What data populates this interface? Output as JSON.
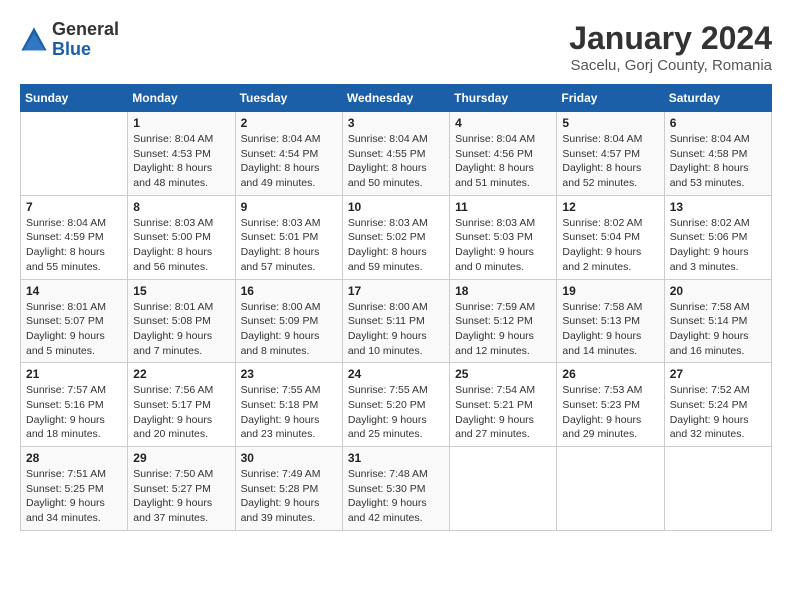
{
  "header": {
    "logo_general": "General",
    "logo_blue": "Blue",
    "title": "January 2024",
    "subtitle": "Sacelu, Gorj County, Romania"
  },
  "weekdays": [
    "Sunday",
    "Monday",
    "Tuesday",
    "Wednesday",
    "Thursday",
    "Friday",
    "Saturday"
  ],
  "weeks": [
    [
      {
        "day": "",
        "info": ""
      },
      {
        "day": "1",
        "info": "Sunrise: 8:04 AM\nSunset: 4:53 PM\nDaylight: 8 hours\nand 48 minutes."
      },
      {
        "day": "2",
        "info": "Sunrise: 8:04 AM\nSunset: 4:54 PM\nDaylight: 8 hours\nand 49 minutes."
      },
      {
        "day": "3",
        "info": "Sunrise: 8:04 AM\nSunset: 4:55 PM\nDaylight: 8 hours\nand 50 minutes."
      },
      {
        "day": "4",
        "info": "Sunrise: 8:04 AM\nSunset: 4:56 PM\nDaylight: 8 hours\nand 51 minutes."
      },
      {
        "day": "5",
        "info": "Sunrise: 8:04 AM\nSunset: 4:57 PM\nDaylight: 8 hours\nand 52 minutes."
      },
      {
        "day": "6",
        "info": "Sunrise: 8:04 AM\nSunset: 4:58 PM\nDaylight: 8 hours\nand 53 minutes."
      }
    ],
    [
      {
        "day": "7",
        "info": "Sunrise: 8:04 AM\nSunset: 4:59 PM\nDaylight: 8 hours\nand 55 minutes."
      },
      {
        "day": "8",
        "info": "Sunrise: 8:03 AM\nSunset: 5:00 PM\nDaylight: 8 hours\nand 56 minutes."
      },
      {
        "day": "9",
        "info": "Sunrise: 8:03 AM\nSunset: 5:01 PM\nDaylight: 8 hours\nand 57 minutes."
      },
      {
        "day": "10",
        "info": "Sunrise: 8:03 AM\nSunset: 5:02 PM\nDaylight: 8 hours\nand 59 minutes."
      },
      {
        "day": "11",
        "info": "Sunrise: 8:03 AM\nSunset: 5:03 PM\nDaylight: 9 hours\nand 0 minutes."
      },
      {
        "day": "12",
        "info": "Sunrise: 8:02 AM\nSunset: 5:04 PM\nDaylight: 9 hours\nand 2 minutes."
      },
      {
        "day": "13",
        "info": "Sunrise: 8:02 AM\nSunset: 5:06 PM\nDaylight: 9 hours\nand 3 minutes."
      }
    ],
    [
      {
        "day": "14",
        "info": "Sunrise: 8:01 AM\nSunset: 5:07 PM\nDaylight: 9 hours\nand 5 minutes."
      },
      {
        "day": "15",
        "info": "Sunrise: 8:01 AM\nSunset: 5:08 PM\nDaylight: 9 hours\nand 7 minutes."
      },
      {
        "day": "16",
        "info": "Sunrise: 8:00 AM\nSunset: 5:09 PM\nDaylight: 9 hours\nand 8 minutes."
      },
      {
        "day": "17",
        "info": "Sunrise: 8:00 AM\nSunset: 5:11 PM\nDaylight: 9 hours\nand 10 minutes."
      },
      {
        "day": "18",
        "info": "Sunrise: 7:59 AM\nSunset: 5:12 PM\nDaylight: 9 hours\nand 12 minutes."
      },
      {
        "day": "19",
        "info": "Sunrise: 7:58 AM\nSunset: 5:13 PM\nDaylight: 9 hours\nand 14 minutes."
      },
      {
        "day": "20",
        "info": "Sunrise: 7:58 AM\nSunset: 5:14 PM\nDaylight: 9 hours\nand 16 minutes."
      }
    ],
    [
      {
        "day": "21",
        "info": "Sunrise: 7:57 AM\nSunset: 5:16 PM\nDaylight: 9 hours\nand 18 minutes."
      },
      {
        "day": "22",
        "info": "Sunrise: 7:56 AM\nSunset: 5:17 PM\nDaylight: 9 hours\nand 20 minutes."
      },
      {
        "day": "23",
        "info": "Sunrise: 7:55 AM\nSunset: 5:18 PM\nDaylight: 9 hours\nand 23 minutes."
      },
      {
        "day": "24",
        "info": "Sunrise: 7:55 AM\nSunset: 5:20 PM\nDaylight: 9 hours\nand 25 minutes."
      },
      {
        "day": "25",
        "info": "Sunrise: 7:54 AM\nSunset: 5:21 PM\nDaylight: 9 hours\nand 27 minutes."
      },
      {
        "day": "26",
        "info": "Sunrise: 7:53 AM\nSunset: 5:23 PM\nDaylight: 9 hours\nand 29 minutes."
      },
      {
        "day": "27",
        "info": "Sunrise: 7:52 AM\nSunset: 5:24 PM\nDaylight: 9 hours\nand 32 minutes."
      }
    ],
    [
      {
        "day": "28",
        "info": "Sunrise: 7:51 AM\nSunset: 5:25 PM\nDaylight: 9 hours\nand 34 minutes."
      },
      {
        "day": "29",
        "info": "Sunrise: 7:50 AM\nSunset: 5:27 PM\nDaylight: 9 hours\nand 37 minutes."
      },
      {
        "day": "30",
        "info": "Sunrise: 7:49 AM\nSunset: 5:28 PM\nDaylight: 9 hours\nand 39 minutes."
      },
      {
        "day": "31",
        "info": "Sunrise: 7:48 AM\nSunset: 5:30 PM\nDaylight: 9 hours\nand 42 minutes."
      },
      {
        "day": "",
        "info": ""
      },
      {
        "day": "",
        "info": ""
      },
      {
        "day": "",
        "info": ""
      }
    ]
  ]
}
